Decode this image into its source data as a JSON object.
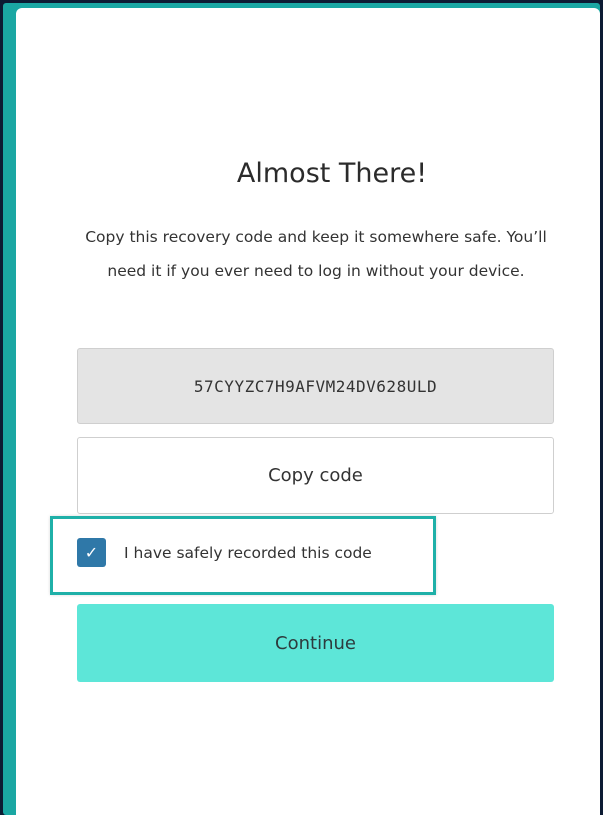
{
  "dialog": {
    "title": "Almost There!",
    "description": "Copy this recovery code and keep it somewhere safe. You’ll need it if you ever need to log in without your device.",
    "recovery_code": "57CYYZC7H9AFVM24DV628ULD",
    "copy_button_label": "Copy code",
    "checkbox": {
      "label": "I have safely recorded this code",
      "checked": true,
      "check_glyph": "✓"
    },
    "continue_button_label": "Continue"
  },
  "colors": {
    "background": "#0c1b33",
    "frame": "#1aa7a3",
    "accent": "#5de6d8",
    "checkbox": "#2f78a8",
    "highlight": "#1fb0a8"
  }
}
